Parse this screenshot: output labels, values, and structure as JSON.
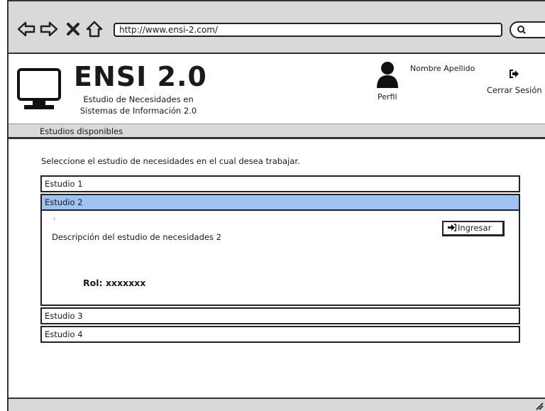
{
  "browser": {
    "url": "http://www.ensi-2.com/"
  },
  "header": {
    "title": "ENSI 2.0",
    "subtitle_line1": "Estudio de Necesidades en",
    "subtitle_line2": "Sistemas de Información 2.0",
    "profile_label": "Perfil",
    "user_name": "Nombre Apellido",
    "logout_label": "Cerrar Sesión"
  },
  "section": {
    "title": "Estudios disponibles"
  },
  "main": {
    "instructions": "Seleccione el estudio de necesidades en el cual desea trabajar.",
    "studies": [
      {
        "label": "Estudio 1"
      },
      {
        "label": "Estudio 2"
      },
      {
        "label": "Estudio 3"
      },
      {
        "label": "Estudio 4"
      }
    ],
    "selected_study": {
      "marker": ".",
      "description": "Descripción del estudio de necesidades 2",
      "role": "Rol: xxxxxxx",
      "enter_label": "Ingresar"
    }
  },
  "colors": {
    "selected_row": "#9ec3f2",
    "chrome_gray": "#d9d9d9"
  },
  "icons": [
    "back-icon",
    "forward-icon",
    "close-icon",
    "home-icon",
    "search-icon",
    "monitor-icon",
    "user-icon",
    "logout-icon",
    "enter-icon"
  ]
}
